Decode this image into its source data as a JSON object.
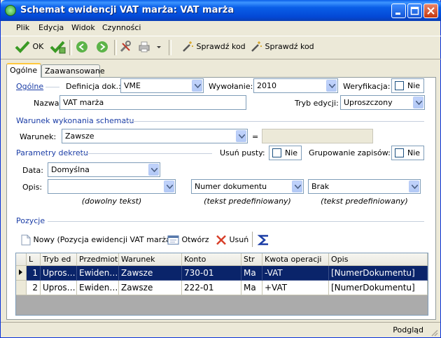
{
  "window": {
    "title": "Schemat ewidencji VAT marża: VAT marża"
  },
  "menu": [
    "Plik",
    "Edycja",
    "Widok",
    "Czynności"
  ],
  "toolbar": {
    "ok_label": "OK",
    "check_code_label": "Sprawdź kod",
    "check_code2_label": "Sprawdź kod"
  },
  "tabs": [
    "Ogólne",
    "Zaawansowane"
  ],
  "general": {
    "section_label": "Ogólne",
    "definicja_label": "Definicja dok.:",
    "definicja_value": "VME",
    "wywolanie_label": "Wywołanie:",
    "wywolanie_value": "2010",
    "weryfikacja_label": "Weryfikacja:",
    "weryfikacja_value": "Nie",
    "nazwa_label": "Nazwa:",
    "nazwa_value": "VAT marża",
    "tryb_label": "Tryb edycji:",
    "tryb_value": "Uproszczony"
  },
  "condition": {
    "section_label": "Warunek wykonania schematu",
    "warunek_label": "Warunek:",
    "warunek_value": "Zawsze",
    "eq_label": "=",
    "eq_value": ""
  },
  "decree": {
    "section_label": "Parametry dekretu",
    "usun_label": "Usuń pusty:",
    "usun_value": "Nie",
    "grupowanie_label": "Grupowanie zapisów:",
    "grupowanie_value": "Nie",
    "data_label": "Data:",
    "data_value": "Domyślna",
    "opis_label": "Opis:",
    "opis1_value": "",
    "opis2_value": "Numer dokumentu",
    "opis3_value": "Brak",
    "hint1": "(dowolny tekst)",
    "hint2": "(tekst predefiniowany)",
    "hint3": "(tekst predefiniowany)"
  },
  "positions": {
    "section_label": "Pozycje",
    "new_label": "Nowy (Pozycja ewidencji VAT marża)",
    "open_label": "Otwórz",
    "delete_label": "Usuń",
    "columns": [
      "L",
      "Tryb ed",
      "Przedmiot",
      "Warunek",
      "Konto",
      "Str",
      "Kwota operacji",
      "Opis"
    ],
    "rows": [
      [
        "1",
        "Upros…",
        "Ewiden…",
        "Zawsze",
        "730-01",
        "Ma",
        "-VAT",
        "[NumerDokumentu]"
      ],
      [
        "2",
        "Upros…",
        "Ewiden…",
        "Zawsze",
        "222-01",
        "Ma",
        "+VAT",
        "[NumerDokumentu]"
      ]
    ]
  },
  "status": {
    "text": "Podgląd"
  }
}
